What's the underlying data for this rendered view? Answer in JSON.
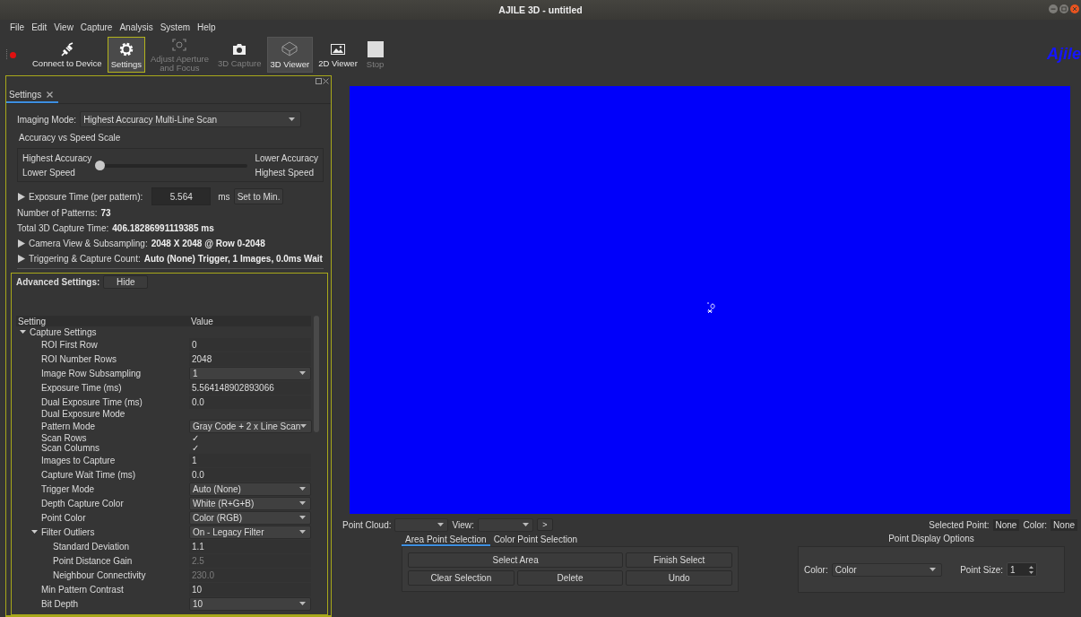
{
  "window": {
    "title": "AJILE 3D - untitled"
  },
  "menu": [
    "File",
    "Edit",
    "View",
    "Capture",
    "Analysis",
    "System",
    "Help"
  ],
  "toolbar": {
    "items": [
      {
        "label": "Connect to Device",
        "kind": "plug",
        "disabled": false,
        "checked": false,
        "focused": false
      },
      {
        "label": "Settings",
        "kind": "gear",
        "disabled": false,
        "checked": true,
        "focused": true
      },
      {
        "label": "Adjust Aperture\nand Focus",
        "kind": "focus",
        "disabled": true,
        "checked": false,
        "focused": false
      },
      {
        "label": "3D Capture",
        "kind": "camera",
        "disabled": true,
        "checked": false,
        "focused": false
      },
      {
        "label": "3D Viewer",
        "kind": "cube",
        "disabled": false,
        "checked": true,
        "focused": false
      },
      {
        "label": "2D Viewer",
        "kind": "image",
        "disabled": false,
        "checked": false,
        "focused": false
      },
      {
        "label": "Stop",
        "kind": "stop",
        "disabled": true,
        "checked": false,
        "focused": false
      }
    ],
    "logo": "Ajile"
  },
  "settings_panel": {
    "tab": {
      "label": "Settings",
      "selected": true
    },
    "imaging_mode": {
      "label": "Imaging Mode:",
      "value": "Highest Accuracy Multi-Line Scan"
    },
    "scale": {
      "title": "Accuracy vs Speed Scale",
      "left": [
        "Highest Accuracy",
        "Lower Speed"
      ],
      "right": [
        "Lower Accuracy",
        "Highest Speed"
      ],
      "level": 0
    },
    "exposure": {
      "label": "Exposure Time (per pattern):",
      "value": "5.564",
      "unit": "ms",
      "button": "Set to Min."
    },
    "info": [
      {
        "label": "Number of Patterns:",
        "value": "73",
        "expandable": false
      },
      {
        "label": "Total 3D Capture Time:",
        "value": "406.18286991119385 ms",
        "expandable": false
      },
      {
        "label": "Camera View & Subsampling:",
        "value": "2048 X 2048 @ Row 0-2048",
        "expandable": true
      },
      {
        "label": "Triggering & Capture Count:",
        "value": "Auto (None) Trigger, 1 Images, 0.0ms Wait",
        "expandable": true
      }
    ],
    "advanced": {
      "label": "Advanced Settings:",
      "button": "Hide"
    },
    "table": {
      "columns": [
        "Setting",
        "Value"
      ],
      "rows": [
        {
          "name": "Capture Settings",
          "kind": "group",
          "expanded": true,
          "children": [
            {
              "name": "ROI First Row",
              "kind": "text",
              "value": "0",
              "disabled": false
            },
            {
              "name": "ROI Number Rows",
              "kind": "text",
              "value": "2048",
              "disabled": false
            },
            {
              "name": "Image Row Subsampling",
              "kind": "dropdown",
              "value": "1",
              "disabled": false
            },
            {
              "name": "Exposure Time (ms)",
              "kind": "text",
              "value": "5.564148902893066",
              "disabled": false
            },
            {
              "name": "Dual Exposure Time (ms)",
              "kind": "text",
              "value": "0.0",
              "disabled": false
            },
            {
              "name": "Dual Exposure Mode",
              "kind": "empty",
              "disabled": false
            },
            {
              "name": "Pattern Mode",
              "kind": "dropdown",
              "value": "Gray Code + 2 x Line Scan",
              "disabled": false
            },
            {
              "name": "Scan Rows",
              "kind": "check",
              "value": "✓",
              "disabled": false
            },
            {
              "name": "Scan Columns",
              "kind": "check",
              "value": "✓",
              "disabled": false
            },
            {
              "name": "Images to Capture",
              "kind": "text",
              "value": "1",
              "disabled": false
            },
            {
              "name": "Capture Wait Time (ms)",
              "kind": "text",
              "value": "0.0",
              "disabled": false
            },
            {
              "name": "Trigger Mode",
              "kind": "dropdown",
              "value": "Auto (None)",
              "disabled": false
            },
            {
              "name": "Depth Capture Color",
              "kind": "dropdown",
              "value": "White (R+G+B)",
              "disabled": false
            },
            {
              "name": "Point Color",
              "kind": "dropdown",
              "value": "Color (RGB)",
              "disabled": false
            },
            {
              "name": "Filter Outliers",
              "kind": "dropdown",
              "value": "On - Legacy Filter",
              "disabled": false,
              "expanded": true,
              "children": [
                {
                  "name": "Standard Deviation",
                  "kind": "text",
                  "value": "1.1",
                  "disabled": false
                },
                {
                  "name": "Point Distance Gain",
                  "kind": "text",
                  "value": "2.5",
                  "disabled": true
                },
                {
                  "name": "Neighbour Connectivity",
                  "kind": "text",
                  "value": "230.0",
                  "disabled": true
                }
              ]
            },
            {
              "name": "Min Pattern Contrast",
              "kind": "text",
              "value": "10",
              "disabled": false
            },
            {
              "name": "Bit Depth",
              "kind": "dropdown",
              "value": "10",
              "disabled": false
            }
          ]
        }
      ]
    }
  },
  "viewer": {
    "point_cloud_label": "Point Cloud:",
    "view_label": "View:",
    "go_button": ">",
    "selected_point_label": "Selected Point:",
    "selected_point_value": "None",
    "color_label": "Color:",
    "color_value": "None",
    "selection_tabs": [
      {
        "label": "Area Point Selection",
        "selected": true
      },
      {
        "label": "Color Point Selection",
        "selected": false
      }
    ],
    "selection_buttons": [
      [
        "Select Area",
        "Finish Select"
      ],
      [
        "Clear Selection",
        "Delete",
        "Undo"
      ]
    ],
    "display_options": {
      "title": "Point Display Options",
      "color_label": "Color:",
      "color_value": "Color",
      "point_size_label": "Point Size:",
      "point_size_value": "1"
    }
  }
}
